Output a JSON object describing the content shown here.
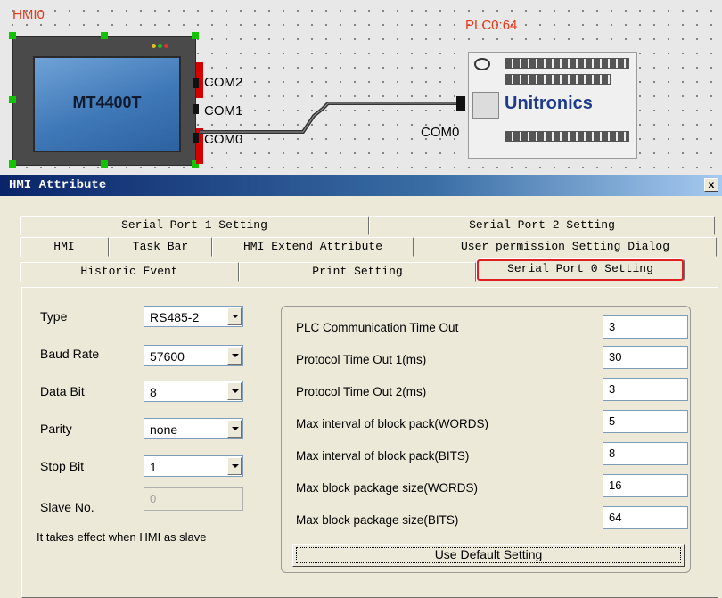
{
  "canvas": {
    "hmi_label": "HMI0",
    "hmi_model": "MT4400T",
    "hmi_ports": [
      "COM2",
      "COM1",
      "COM0"
    ],
    "plc_label": "PLC0:64",
    "plc_port": "COM0",
    "plc_brand": "Unitronics",
    "colors": {
      "label": "#e8391a",
      "handle": "#12c400",
      "cable": "#333333"
    }
  },
  "dialog": {
    "title": "HMI Attribute",
    "close_label": "x",
    "tabs_row1": [
      "Serial Port 1 Setting",
      "Serial Port 2 Setting"
    ],
    "tabs_row2": [
      "HMI",
      "Task Bar",
      "HMI Extend Attribute",
      "User permission Setting Dialog"
    ],
    "tabs_row3": [
      "Historic Event",
      "Print Setting",
      "Serial Port 0 Setting"
    ],
    "active_tab": "Serial Port 0 Setting",
    "fields": {
      "type": {
        "label": "Type",
        "value": "RS485-2"
      },
      "baud_rate": {
        "label": "Baud Rate",
        "value": "57600"
      },
      "data_bit": {
        "label": "Data Bit",
        "value": "8"
      },
      "parity": {
        "label": "Parity",
        "value": "none"
      },
      "stop_bit": {
        "label": "Stop Bit",
        "value": "1"
      },
      "slave_no": {
        "label": "Slave No.",
        "value": "0"
      }
    },
    "note": "It takes effect when HMI as slave",
    "params": [
      {
        "label": "PLC Communication Time Out",
        "value": "3"
      },
      {
        "label": "Protocol Time Out 1(ms)",
        "value": "30"
      },
      {
        "label": "Protocol Time Out 2(ms)",
        "value": "3"
      },
      {
        "label": "Max interval of block pack(WORDS)",
        "value": "5"
      },
      {
        "label": "Max interval of block pack(BITS)",
        "value": "8"
      },
      {
        "label": "Max block package size(WORDS)",
        "value": "16"
      },
      {
        "label": "Max block package size(BITS)",
        "value": "64"
      }
    ],
    "default_button": "Use Default Setting"
  }
}
